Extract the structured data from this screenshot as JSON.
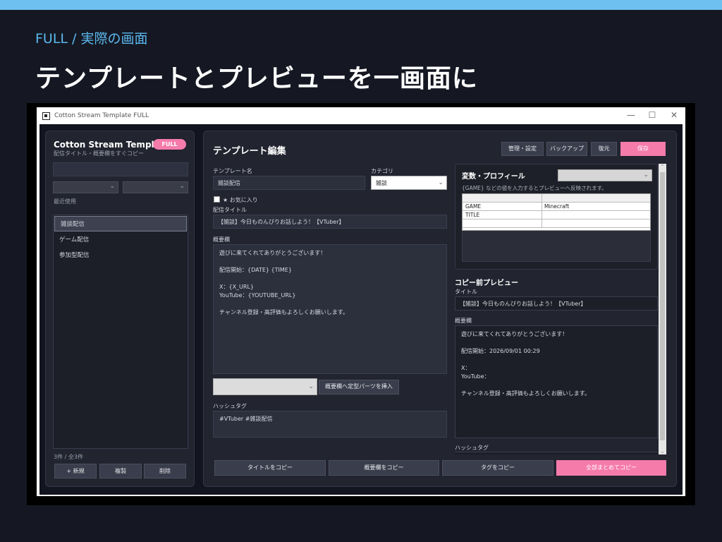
{
  "slide": {
    "subtitle": "FULL / 実際の画面",
    "title": "テンプレートとプレビューを一画面に"
  },
  "window": {
    "title": "Cotton Stream Template FULL",
    "minimize": "—",
    "maximize": "☐",
    "close": "✕"
  },
  "sidebar": {
    "app_name": "Cotton Stream Template",
    "badge": "FULL",
    "description": "配信タイトル・概要欄をすぐコピー",
    "search_value": "",
    "filter1": "",
    "filter2": "",
    "recent_label": "最近使用",
    "templates": [
      {
        "label": "雑談配信",
        "selected": true
      },
      {
        "label": "ゲーム配信",
        "selected": false
      },
      {
        "label": "参加型配信",
        "selected": false
      }
    ],
    "count": "3件 / 全3件",
    "buttons": {
      "new": "+ 新規",
      "duplicate": "複製",
      "delete": "削除"
    }
  },
  "editor": {
    "heading": "テンプレート編集",
    "toolbar": {
      "manage": "管理・設定",
      "backup": "バックアップ",
      "restore": "復元",
      "save": "保存"
    },
    "name_label": "テンプレート名",
    "name_value": "雑談配信",
    "category_label": "カテゴリ",
    "category_value": "雑談",
    "favorite_label": "★ お気に入り",
    "title_label": "配信タイトル",
    "title_value": "【雑談】今日ものんびりお話しよう！【VTuber】",
    "desc_label": "概要欄",
    "desc_value": "遊びに来てくれてありがとうございます！\n\n配信開始：{DATE} {TIME}\n\nX：{X_URL}\nYouTube：{YOUTUBE_URL}\n\nチャンネル登録・高評価もよろしくお願いします。",
    "parts_select": "",
    "insert_button": "概要欄へ定型パーツを挿入",
    "hashtag_label": "ハッシュタグ",
    "hashtag_value": "#VTuber #雑談配信"
  },
  "variables": {
    "heading": "変数・プロフィール",
    "profile_select": "",
    "hint": "{GAME} などの値を入力するとプレビューへ反映されます。",
    "rows": [
      {
        "key": "",
        "value": ""
      },
      {
        "key": "GAME",
        "value": "Minecraft"
      },
      {
        "key": "TITLE",
        "value": ""
      },
      {
        "key": "",
        "value": ""
      }
    ]
  },
  "preview": {
    "heading": "コピー前プレビュー",
    "title_label": "タイトル",
    "title_value": "【雑談】今日ものんびりお話しよう！【VTuber】",
    "desc_label": "概要欄",
    "desc_value": "遊びに来てくれてありがとうございます！\n\n配信開始：2026/09/01 00:29\n\nX：\nYouTube：\n\nチャンネル登録・高評価もよろしくお願いします。",
    "hashtag_label": "ハッシュタグ"
  },
  "bottom_buttons": {
    "copy_title": "タイトルをコピー",
    "copy_desc": "概要欄をコピー",
    "copy_tags": "タグをコピー",
    "copy_all": "全部まとめてコピー"
  },
  "colors": {
    "accent_pink": "#f57bab",
    "slide_accent": "#5bb8ee",
    "background": "#151823",
    "panel": "#22242f"
  }
}
